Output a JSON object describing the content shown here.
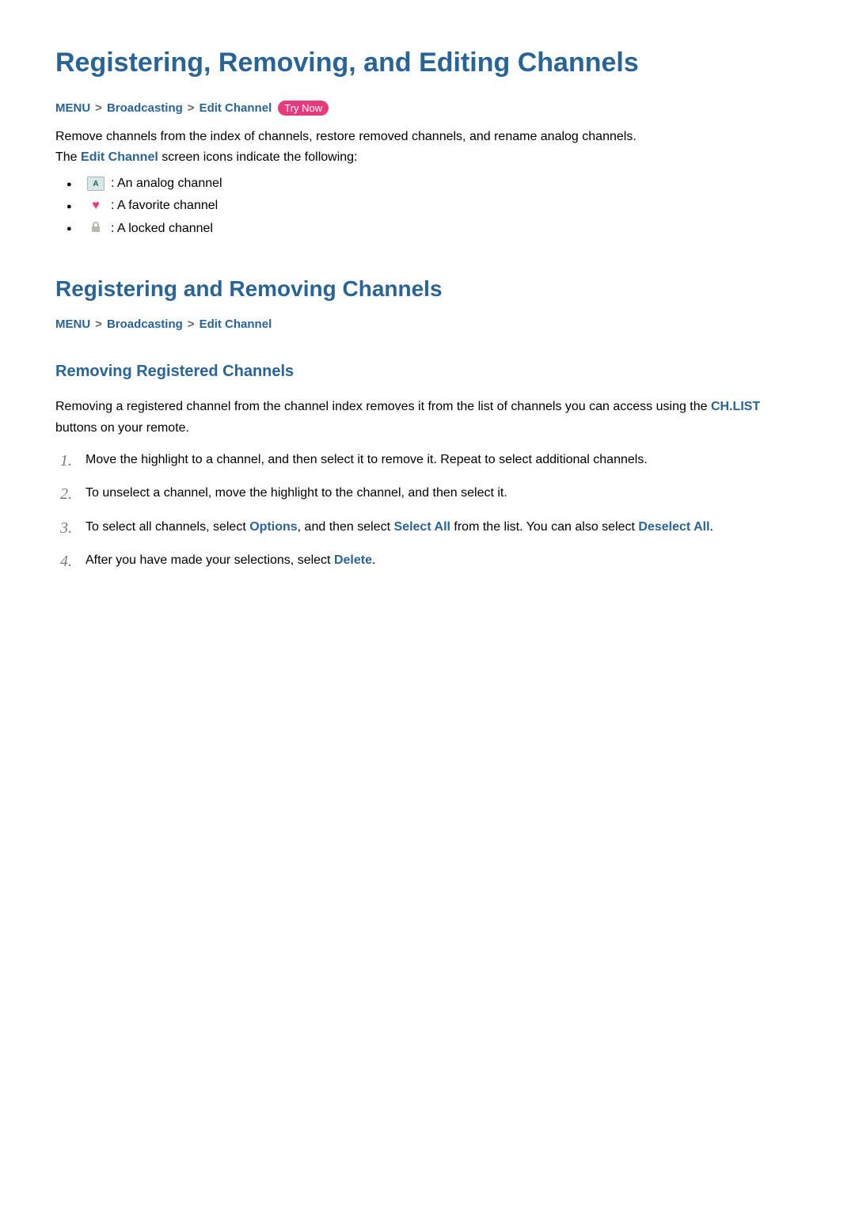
{
  "page_title": "Registering, Removing, and Editing Channels",
  "breadcrumb1": {
    "menu": "MENU",
    "broadcasting": "Broadcasting",
    "edit_channel": "Edit Channel",
    "try_now": "Try Now",
    "sep": ">"
  },
  "intro": {
    "line1": "Remove channels from the index of channels, restore removed channels, and rename analog channels.",
    "line2_prefix": "The ",
    "line2_bold": "Edit Channel",
    "line2_suffix": " screen icons indicate the following:"
  },
  "icons": {
    "analog_symbol": "A",
    "analog_desc": " : An analog channel",
    "favorite_desc": " : A favorite channel",
    "locked_desc": " : A locked channel"
  },
  "section2": {
    "title": "Registering and Removing Channels",
    "breadcrumb": {
      "menu": "MENU",
      "broadcasting": "Broadcasting",
      "edit_channel": "Edit Channel",
      "sep": ">"
    }
  },
  "subsection": {
    "title": "Removing Registered Channels",
    "intro_prefix": "Removing a registered channel from the channel index removes it from the list of channels you can access using the ",
    "intro_bold": "CH.LIST",
    "intro_suffix": " buttons on your remote.",
    "steps": {
      "s1": "Move the highlight to a channel, and then select it to remove it. Repeat to select additional channels.",
      "s2": "To unselect a channel, move the highlight to the channel, and then select it.",
      "s3_a": "To select all channels, select ",
      "s3_b": "Options",
      "s3_c": ", and then select ",
      "s3_d": "Select All",
      "s3_e": " from the list. You can also select ",
      "s3_f": "Deselect All",
      "s3_g": ".",
      "s4_a": "After you have made your selections, select ",
      "s4_b": "Delete",
      "s4_c": "."
    }
  }
}
